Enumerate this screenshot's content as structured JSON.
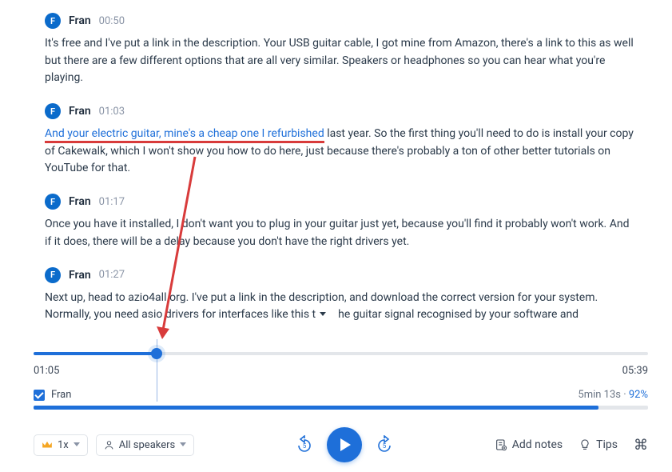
{
  "transcript": [
    {
      "avatar": "F",
      "speaker": "Fran",
      "time": "00:50",
      "text": "It's free and I've put a link in the description. Your USB guitar cable, I got mine from Amazon, there's a link to this as well but there are a few different options that are all very similar. Speakers or headphones so you can hear what you're playing."
    },
    {
      "avatar": "F",
      "speaker": "Fran",
      "time": "01:03",
      "highlight": "And your electric guitar, mine's a cheap one I refurbished",
      "text_after": " last year. So the first thing you'll need to do is install your copy of Cakewalk, which I won't show you how to do here, just because there's probably a ton of other better tutorials on YouTube for that."
    },
    {
      "avatar": "F",
      "speaker": "Fran",
      "time": "01:17",
      "text": "Once you have it installed, I don't want you to plug in your guitar just yet, because you'll find it probably won't work. And if it does, there will be a delay because you don't have the right drivers yet."
    },
    {
      "avatar": "F",
      "speaker": "Fran",
      "time": "01:27",
      "text_pre": "Next up, head to azio4all.org. I've put a link in the description, and download the correct version for your system. Normally, you need asio drivers for interfaces like this t",
      "text_post": "he guitar signal recognised by your software and"
    }
  ],
  "player": {
    "current_time": "01:05",
    "total_time": "05:39",
    "progress_pct": 20,
    "speaker_label": "Fran",
    "speaker_duration": "5min 13s",
    "speaker_sep": " · ",
    "speaker_pct": "92%",
    "speed_label": "1x",
    "speakers_filter": "All speakers",
    "skip_seconds": "5",
    "add_notes": "Add notes",
    "tips": "Tips"
  }
}
